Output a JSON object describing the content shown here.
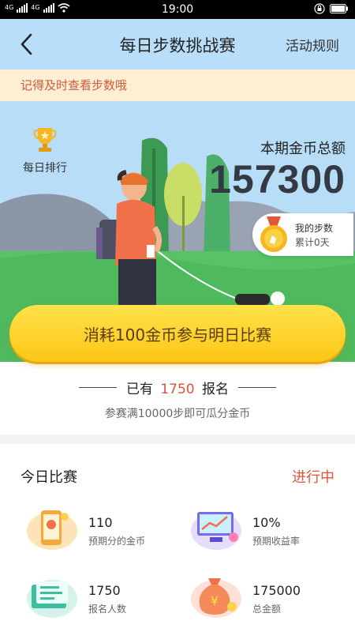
{
  "status_bar": {
    "time": "19:00",
    "network": "4G",
    "signal_text": "4G"
  },
  "header": {
    "title": "每日步数挑战赛",
    "rules_label": "活动规则"
  },
  "notice": {
    "text": "记得及时查看步数哦"
  },
  "hero": {
    "daily_rank_label": "每日排行",
    "total_label": "本期金币总额",
    "total_value": "157300",
    "my_steps_label": "我的步数",
    "my_steps_value": "累计0天"
  },
  "join_button": {
    "label": "消耗100金币参与明日比赛"
  },
  "signup": {
    "prefix": "已有",
    "count": "1750",
    "suffix": "报名",
    "note": "参赛满10000步即可瓜分金币"
  },
  "today": {
    "title": "今日比赛",
    "status": "进行中",
    "stats": [
      {
        "value": "110",
        "label": "预期分的金币",
        "icon": "phone-coin-icon"
      },
      {
        "value": "10%",
        "label": "预期收益率",
        "icon": "chart-screen-icon"
      },
      {
        "value": "1750",
        "label": "报名人数",
        "icon": "registration-card-icon"
      },
      {
        "value": "175000",
        "label": "总金额",
        "icon": "money-bag-icon"
      }
    ]
  },
  "colors": {
    "accent": "#e0533a",
    "header_bg": "#b9def9",
    "notice_bg": "#fdeed4",
    "button": "#fcc616"
  }
}
